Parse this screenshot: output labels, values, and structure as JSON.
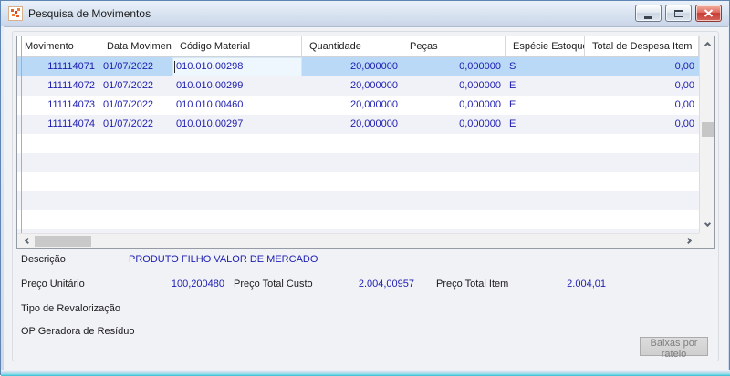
{
  "window": {
    "title": "Pesquisa de Movimentos",
    "controls": {
      "minimize": "minimize",
      "maximize": "maximize",
      "close": "close"
    }
  },
  "grid": {
    "columns": [
      {
        "key": "movimento",
        "label": "Movimento",
        "align": "right"
      },
      {
        "key": "data_movimento",
        "label": "Data Movimento",
        "align": "left"
      },
      {
        "key": "codigo_material",
        "label": "Código Material",
        "align": "left"
      },
      {
        "key": "quantidade",
        "label": "Quantidade",
        "align": "right"
      },
      {
        "key": "pecas",
        "label": "Peças",
        "align": "right"
      },
      {
        "key": "especie_estoque",
        "label": "Espécie Estoque",
        "align": "left"
      },
      {
        "key": "total_despesa_item",
        "label": "Total de Despesa Item",
        "align": "right"
      }
    ],
    "rows": [
      {
        "movimento": "111114071",
        "data_movimento": "01/07/2022",
        "codigo_material": "010.010.00298",
        "quantidade": "20,000000",
        "pecas": "0,000000",
        "especie_estoque": "S",
        "total_despesa_item": "0,00",
        "selected": true,
        "editing_cell": "codigo_material"
      },
      {
        "movimento": "111114072",
        "data_movimento": "01/07/2022",
        "codigo_material": "010.010.00299",
        "quantidade": "20,000000",
        "pecas": "0,000000",
        "especie_estoque": "E",
        "total_despesa_item": "0,00"
      },
      {
        "movimento": "111114073",
        "data_movimento": "01/07/2022",
        "codigo_material": "010.010.00460",
        "quantidade": "20,000000",
        "pecas": "0,000000",
        "especie_estoque": "E",
        "total_despesa_item": "0,00"
      },
      {
        "movimento": "111114074",
        "data_movimento": "01/07/2022",
        "codigo_material": "010.010.00297",
        "quantidade": "20,000000",
        "pecas": "0,000000",
        "especie_estoque": "E",
        "total_despesa_item": "0,00"
      }
    ],
    "empty_row_count": 6
  },
  "details": {
    "descricao_label": "Descrição",
    "descricao_value": "PRODUTO FILHO VALOR DE MERCADO",
    "preco_unitario_label": "Preço Unitário",
    "preco_unitario_value": "100,200480",
    "preco_total_custo_label": "Preço Total Custo",
    "preco_total_custo_value": "2.004,00957",
    "preco_total_item_label": "Preço Total Item",
    "preco_total_item_value": "2.004,01",
    "tipo_revalorizacao_label": "Tipo de Revalorização",
    "op_geradora_label": "OP Geradora de Resíduo"
  },
  "footer": {
    "baixas_button_label": "Baixas por rateio",
    "baixas_button_disabled": true
  },
  "colors": {
    "selection_row": "#b9d9f7",
    "alt_row": "#f1f2f7",
    "grid_value_text": "#1d1db0",
    "close_button": "#c63b33",
    "bottom_frame_accent": "#2fbcd2"
  }
}
